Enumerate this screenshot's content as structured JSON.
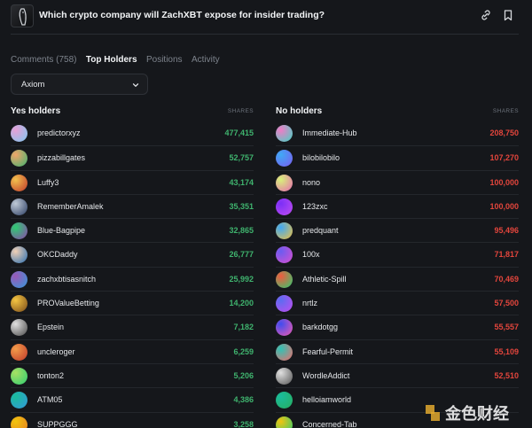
{
  "market": {
    "title": "Which crypto company will ZachXBT expose for insider trading?",
    "link_icon": "link-icon",
    "bookmark_icon": "bookmark-icon"
  },
  "tabs": [
    {
      "label": "Comments (758)",
      "active": false
    },
    {
      "label": "Top Holders",
      "active": true
    },
    {
      "label": "Positions",
      "active": false
    },
    {
      "label": "Activity",
      "active": false
    }
  ],
  "filter": {
    "selected": "Axiom"
  },
  "yes_holders": {
    "title": "Yes holders",
    "shares_label": "SHARES",
    "rows": [
      {
        "name": "predictorxyz",
        "shares": "477,415",
        "avatar": [
          "#e7a0d6",
          "#7fc8f0"
        ]
      },
      {
        "name": "pizzabillgates",
        "shares": "52,757",
        "avatar": [
          "#f0a56a",
          "#3fb36e"
        ]
      },
      {
        "name": "Luffy3",
        "shares": "43,174",
        "avatar": [
          "#f2c14e",
          "#c0392b"
        ]
      },
      {
        "name": "RememberAmalek",
        "shares": "35,351",
        "avatar": [
          "#bfc9d6",
          "#2c3e63"
        ]
      },
      {
        "name": "Blue-Bagpipe",
        "shares": "32,865",
        "avatar": [
          "#2ecc71",
          "#8e44ad"
        ]
      },
      {
        "name": "OKCDaddy",
        "shares": "26,777",
        "avatar": [
          "#f1d0b5",
          "#2a6fb0"
        ]
      },
      {
        "name": "zachxbtisasnitch",
        "shares": "25,992",
        "avatar": [
          "#9b59b6",
          "#3498db"
        ]
      },
      {
        "name": "PROValueBetting",
        "shares": "14,200",
        "avatar": [
          "#f4c542",
          "#7a4b1a"
        ]
      },
      {
        "name": "Epstein",
        "shares": "7,182",
        "avatar": [
          "#e0e0e0",
          "#4a4a4a"
        ]
      },
      {
        "name": "uncleroger",
        "shares": "6,259",
        "avatar": [
          "#f39c4a",
          "#c0392b"
        ]
      },
      {
        "name": "tonton2",
        "shares": "5,206",
        "avatar": [
          "#a8e063",
          "#2ecc71"
        ]
      },
      {
        "name": "ATM05",
        "shares": "4,386",
        "avatar": [
          "#1abc9c",
          "#3498db"
        ]
      },
      {
        "name": "SUPPGGG",
        "shares": "3,258",
        "avatar": [
          "#f1c40f",
          "#e67e22"
        ]
      }
    ]
  },
  "no_holders": {
    "title": "No holders",
    "shares_label": "SHARES",
    "rows": [
      {
        "name": "Immediate-Hub",
        "shares": "208,750",
        "avatar": [
          "#f07cc6",
          "#3fd6c4"
        ]
      },
      {
        "name": "bilobilobilo",
        "shares": "107,270",
        "avatar": [
          "#3fa9f5",
          "#7b5cf0"
        ]
      },
      {
        "name": "nono",
        "shares": "100,000",
        "avatar": [
          "#d8f27a",
          "#e86bb0"
        ]
      },
      {
        "name": "123zxc",
        "shares": "100,000",
        "avatar": [
          "#7b2ff7",
          "#c04df0"
        ]
      },
      {
        "name": "predquant",
        "shares": "95,496",
        "avatar": [
          "#3fa9f5",
          "#f0c040"
        ]
      },
      {
        "name": "100x",
        "shares": "71,817",
        "avatar": [
          "#6a5cf0",
          "#d94fd0"
        ]
      },
      {
        "name": "Athletic-Spill",
        "shares": "70,469",
        "avatar": [
          "#f05b3f",
          "#2ecc71"
        ]
      },
      {
        "name": "nrtlz",
        "shares": "57,500",
        "avatar": [
          "#5b6cf0",
          "#c04df0"
        ]
      },
      {
        "name": "barkdotgg",
        "shares": "55,557",
        "avatar": [
          "#3f4cf0",
          "#f05bb0"
        ]
      },
      {
        "name": "Fearful-Permit",
        "shares": "55,109",
        "avatar": [
          "#2ec4b6",
          "#f06b6b"
        ]
      },
      {
        "name": "WordleAddict",
        "shares": "52,510",
        "avatar": [
          "#e0e0e0",
          "#555555"
        ]
      },
      {
        "name": "helloiamworld",
        "shares": "",
        "avatar": [
          "#1abc9c",
          "#27ae60"
        ]
      },
      {
        "name": "Concerned-Tab",
        "shares": "",
        "avatar": [
          "#f1c40f",
          "#2ecc71"
        ]
      }
    ]
  },
  "watermark": {
    "text": "金色财经"
  },
  "colors": {
    "background": "#15171b",
    "yes": "#3fb36e",
    "no": "#e2453c",
    "text": "#e6e8eb",
    "muted": "#7d838c"
  }
}
